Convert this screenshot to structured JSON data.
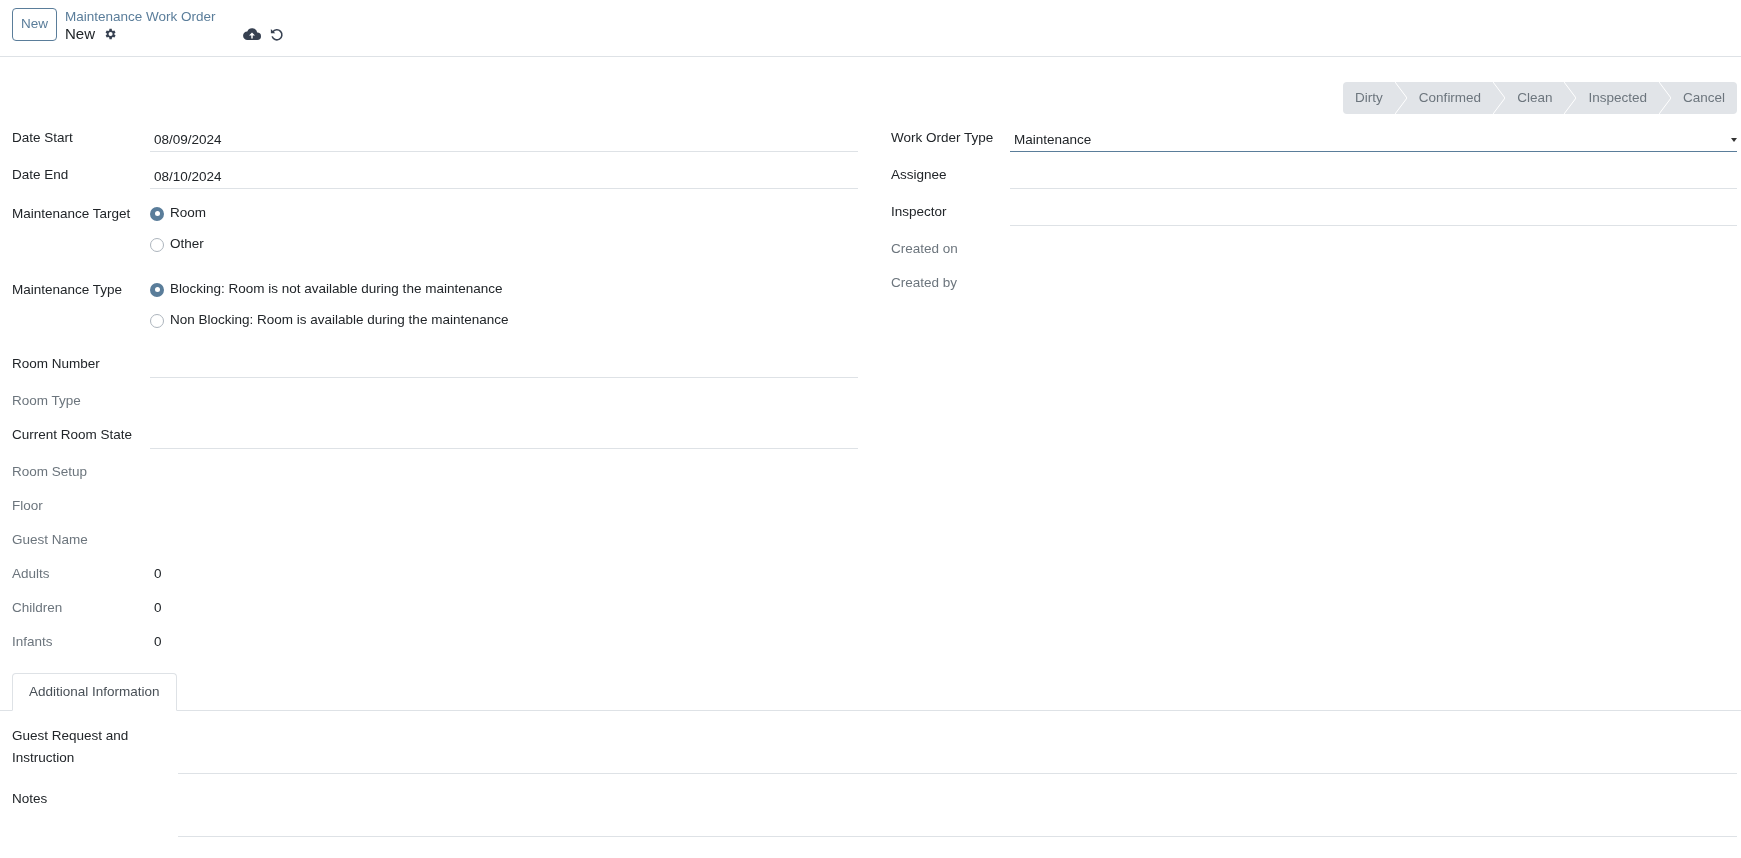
{
  "control_panel": {
    "new_button": "New",
    "breadcrumb": "Maintenance Work Order",
    "record_name": "New"
  },
  "status_bar": [
    {
      "label": "Dirty",
      "selected": false
    },
    {
      "label": "Confirmed",
      "selected": false
    },
    {
      "label": "Clean",
      "selected": false
    },
    {
      "label": "Inspected",
      "selected": false
    },
    {
      "label": "Cancel",
      "selected": false
    }
  ],
  "left_fields": [
    {
      "kind": "input",
      "label": "Date Start",
      "value": "08/09/2024",
      "readonly": false
    },
    {
      "kind": "input",
      "label": "Date End",
      "value": "08/10/2024",
      "readonly": false
    },
    {
      "kind": "radio",
      "label": "Maintenance Target",
      "options": [
        {
          "label": "Room",
          "selected": true
        },
        {
          "label": "Other",
          "selected": false
        }
      ]
    },
    {
      "kind": "radio",
      "label": "Maintenance Type",
      "options": [
        {
          "label": "Blocking: Room is not available during the maintenance",
          "selected": true
        },
        {
          "label": "Non Blocking: Room is available during the maintenance",
          "selected": false
        }
      ]
    },
    {
      "kind": "input",
      "label": "Room Number",
      "readonly": false
    },
    {
      "kind": "input",
      "label": "Room Type",
      "readonly": true
    },
    {
      "kind": "input",
      "label": "Current Room State",
      "readonly": false
    },
    {
      "kind": "input",
      "label": "Room Setup",
      "readonly": true
    },
    {
      "kind": "input",
      "label": "Floor",
      "readonly": true
    },
    {
      "kind": "input",
      "label": "Guest Name",
      "readonly": true
    },
    {
      "kind": "input",
      "label": "Adults",
      "value": "0",
      "readonly": true
    },
    {
      "kind": "input",
      "label": "Children",
      "value": "0",
      "readonly": true
    },
    {
      "kind": "input",
      "label": "Infants",
      "value": "0",
      "readonly": true
    }
  ],
  "right_fields": [
    {
      "kind": "select",
      "label": "Work Order Type",
      "value": "Maintenance",
      "readonly": false
    },
    {
      "kind": "input",
      "label": "Assignee",
      "readonly": false
    },
    {
      "kind": "input",
      "label": "Inspector",
      "readonly": false
    },
    {
      "kind": "input",
      "label": "Created on",
      "readonly": true
    },
    {
      "kind": "input",
      "label": "Created by",
      "readonly": true
    }
  ],
  "tabs": [
    {
      "label": "Additional Information",
      "selected": true
    }
  ],
  "tab_fields": [
    {
      "label": "Guest Request and Instruction"
    },
    {
      "label": "Notes"
    }
  ]
}
